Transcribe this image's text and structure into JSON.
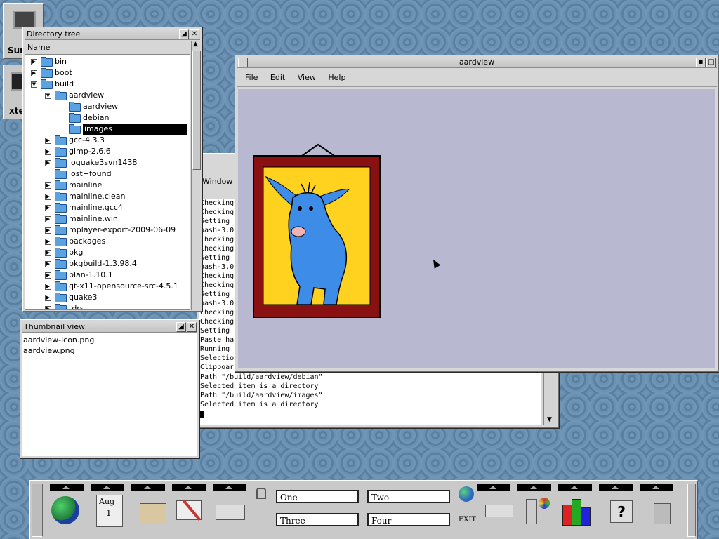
{
  "desktop_icons": [
    {
      "label": "Sun"
    },
    {
      "label": "xte"
    }
  ],
  "dirtree": {
    "title": "Directory tree",
    "column": "Name",
    "items": [
      {
        "label": "bin",
        "depth": 0,
        "exp": "+"
      },
      {
        "label": "boot",
        "depth": 0,
        "exp": "+"
      },
      {
        "label": "build",
        "depth": 0,
        "exp": "-"
      },
      {
        "label": "aardview",
        "depth": 1,
        "exp": "-"
      },
      {
        "label": "aardview",
        "depth": 2,
        "exp": ""
      },
      {
        "label": "debian",
        "depth": 2,
        "exp": ""
      },
      {
        "label": "images",
        "depth": 2,
        "exp": "",
        "selected": true
      },
      {
        "label": "gcc-4.3.3",
        "depth": 1,
        "exp": "+"
      },
      {
        "label": "gimp-2.6.6",
        "depth": 1,
        "exp": "+"
      },
      {
        "label": "ioquake3svn1438",
        "depth": 1,
        "exp": "+"
      },
      {
        "label": "lost+found",
        "depth": 1,
        "exp": ""
      },
      {
        "label": "mainline",
        "depth": 1,
        "exp": "+"
      },
      {
        "label": "mainline.clean",
        "depth": 1,
        "exp": "+"
      },
      {
        "label": "mainline.gcc4",
        "depth": 1,
        "exp": "+"
      },
      {
        "label": "mainline.win",
        "depth": 1,
        "exp": "+"
      },
      {
        "label": "mplayer-export-2009-06-09",
        "depth": 1,
        "exp": "+"
      },
      {
        "label": "packages",
        "depth": 1,
        "exp": "+"
      },
      {
        "label": "pkg",
        "depth": 1,
        "exp": "+"
      },
      {
        "label": "pkgbuild-1.3.98.4",
        "depth": 1,
        "exp": "+"
      },
      {
        "label": "plan-1.10.1",
        "depth": 1,
        "exp": "+"
      },
      {
        "label": "qt-x11-opensource-src-4.5.1",
        "depth": 1,
        "exp": "+"
      },
      {
        "label": "quake3",
        "depth": 1,
        "exp": "+"
      },
      {
        "label": "tdrs",
        "depth": 1,
        "exp": "+"
      }
    ]
  },
  "thumbnail": {
    "title": "Thumbnail view",
    "files": [
      "aardview-icon.png",
      "aardview.png"
    ]
  },
  "terminal": {
    "menu": "Window",
    "lines_partial": [
      "Checking",
      "Checking",
      "Setting",
      "bash-3.0",
      "Checking",
      "Checking",
      "Setting",
      "bash-3.0",
      "Checking",
      "Checking",
      "Setting",
      "bash-3.0",
      "Checking",
      "Checking",
      "Setting",
      "Paste ha",
      "Running",
      "Selectio",
      "Clipboar"
    ],
    "lines_full": [
      "Path \"/build/aardview/debian\"",
      "Selected item is a directory",
      "Path \"/build/aardview/images\"",
      "Selected item is a directory"
    ]
  },
  "aardview": {
    "title": "aardview",
    "menu": {
      "file": "File",
      "edit": "Edit",
      "view": "View",
      "help": "Help"
    },
    "colors": {
      "canvas": "#b8b8d0",
      "frame": "#8a1111",
      "mat": "#ffd21f",
      "creature": "#3d8ce8"
    }
  },
  "panel": {
    "date": {
      "month": "Aug",
      "day": "1"
    },
    "workspaces": {
      "one": "One",
      "two": "Two",
      "three": "Three",
      "four": "Four"
    },
    "exit": "EXIT"
  }
}
